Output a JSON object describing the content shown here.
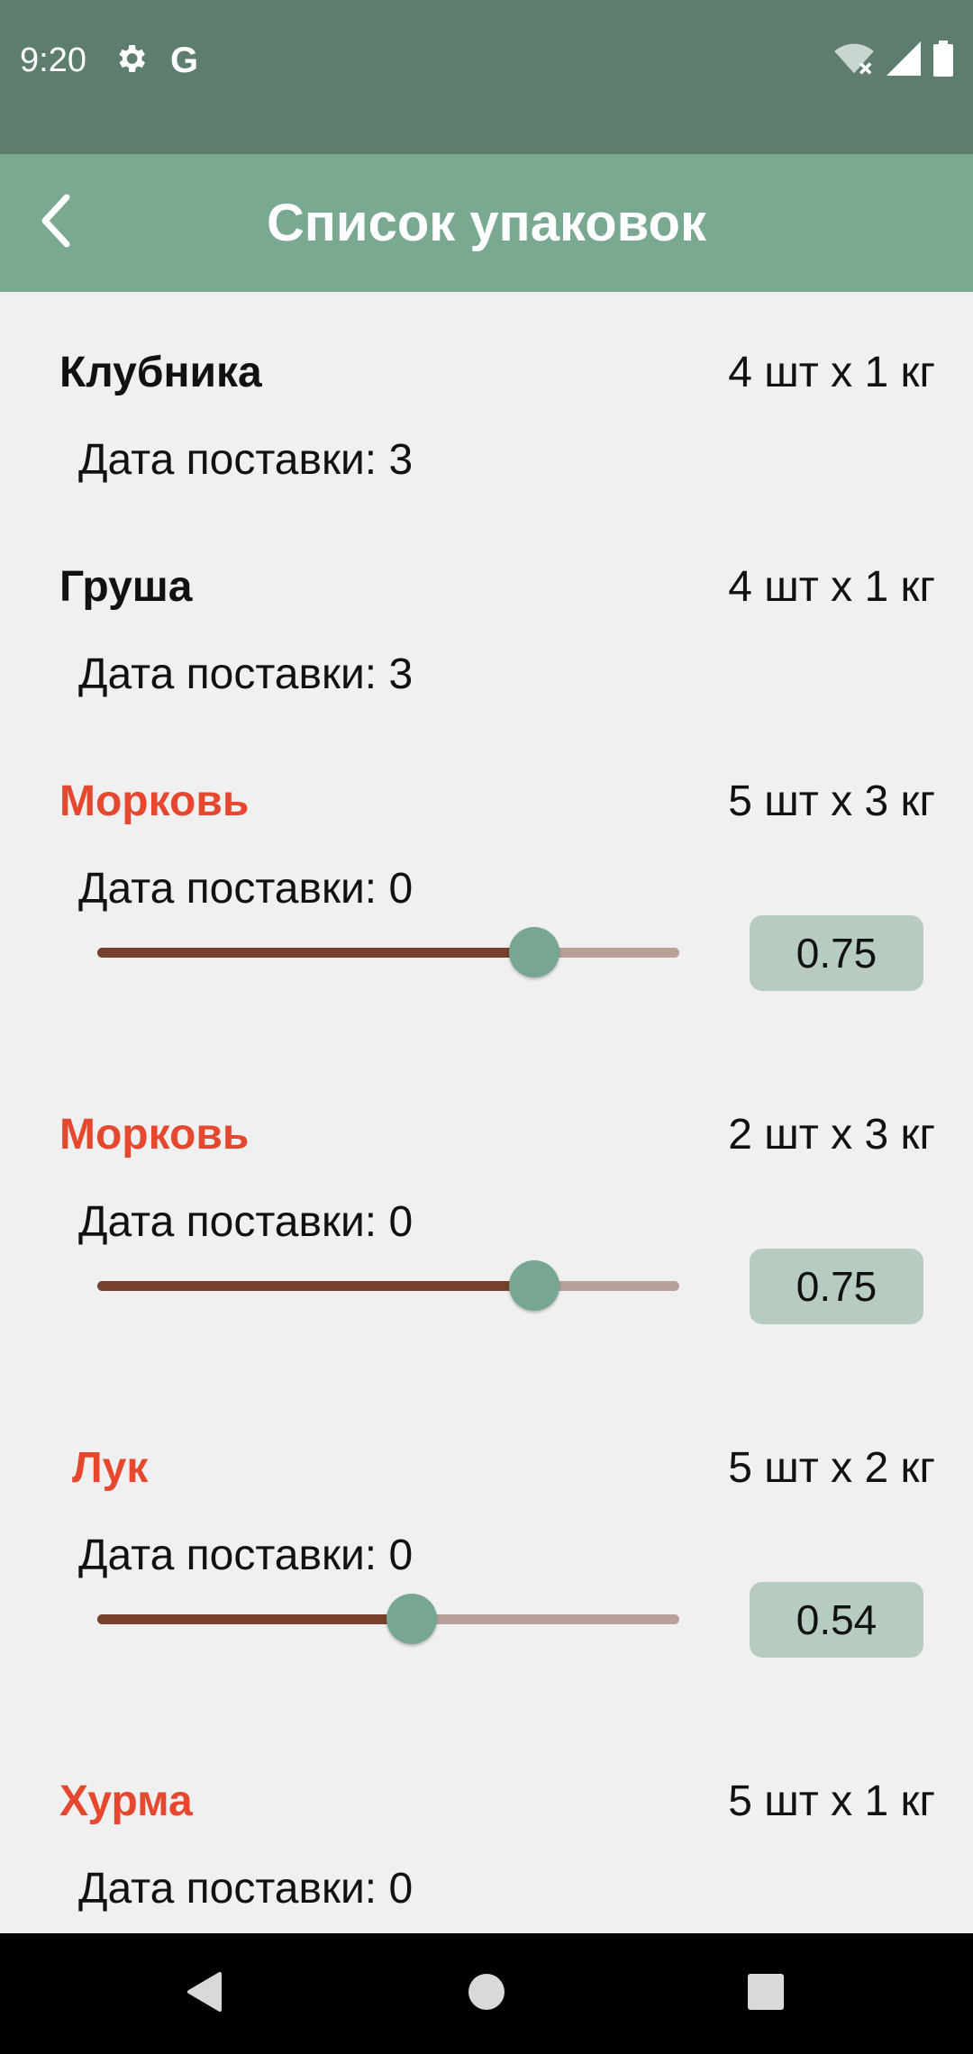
{
  "status_bar": {
    "time": "9:20",
    "left_icons": [
      "gear-icon",
      "google-icon"
    ],
    "right_icons": [
      "wifi-off-icon",
      "signal-icon",
      "battery-icon"
    ],
    "google_letter": "G"
  },
  "app_bar": {
    "title": "Список упаковок",
    "back_icon": "chevron-left-icon"
  },
  "items": [
    {
      "name": "Клубника",
      "quantity": "4 шт х 1 кг",
      "date": "Дата поставки: 3",
      "highlight": false
    },
    {
      "name": "Груша",
      "quantity": "4 шт х 1 кг",
      "date": "Дата поставки: 3",
      "highlight": false
    },
    {
      "name": "Морковь",
      "quantity": "5 шт х 3 кг",
      "date": "Дата поставки: 0",
      "highlight": true,
      "slider_value": 0.75,
      "value_text": "0.75"
    },
    {
      "name": "Морковь",
      "quantity": "2 шт х 3 кг",
      "date": "Дата поставки: 0",
      "highlight": true,
      "slider_value": 0.75,
      "value_text": "0.75"
    },
    {
      "name": "Лук",
      "quantity": "5 шт х 2 кг",
      "date": "Дата поставки: 0",
      "highlight": true,
      "slider_value": 0.54,
      "value_text": "0.54"
    },
    {
      "name": "Хурма",
      "quantity": "5 шт х 1 кг",
      "date": "Дата поставки: 0",
      "highlight": true
    }
  ],
  "colors": {
    "status_bar": "#5d7d6d",
    "app_bar": "#7aa991",
    "background": "#f1f0f0",
    "highlight_text": "#e5482f",
    "slider_active": "#75412c",
    "slider_inactive": "#b9a19a",
    "slider_thumb": "#77a793",
    "value_box": "#b6ccc0"
  },
  "nav_bar": {
    "buttons": [
      "back-triangle-icon",
      "home-circle-icon",
      "recents-square-icon"
    ]
  }
}
